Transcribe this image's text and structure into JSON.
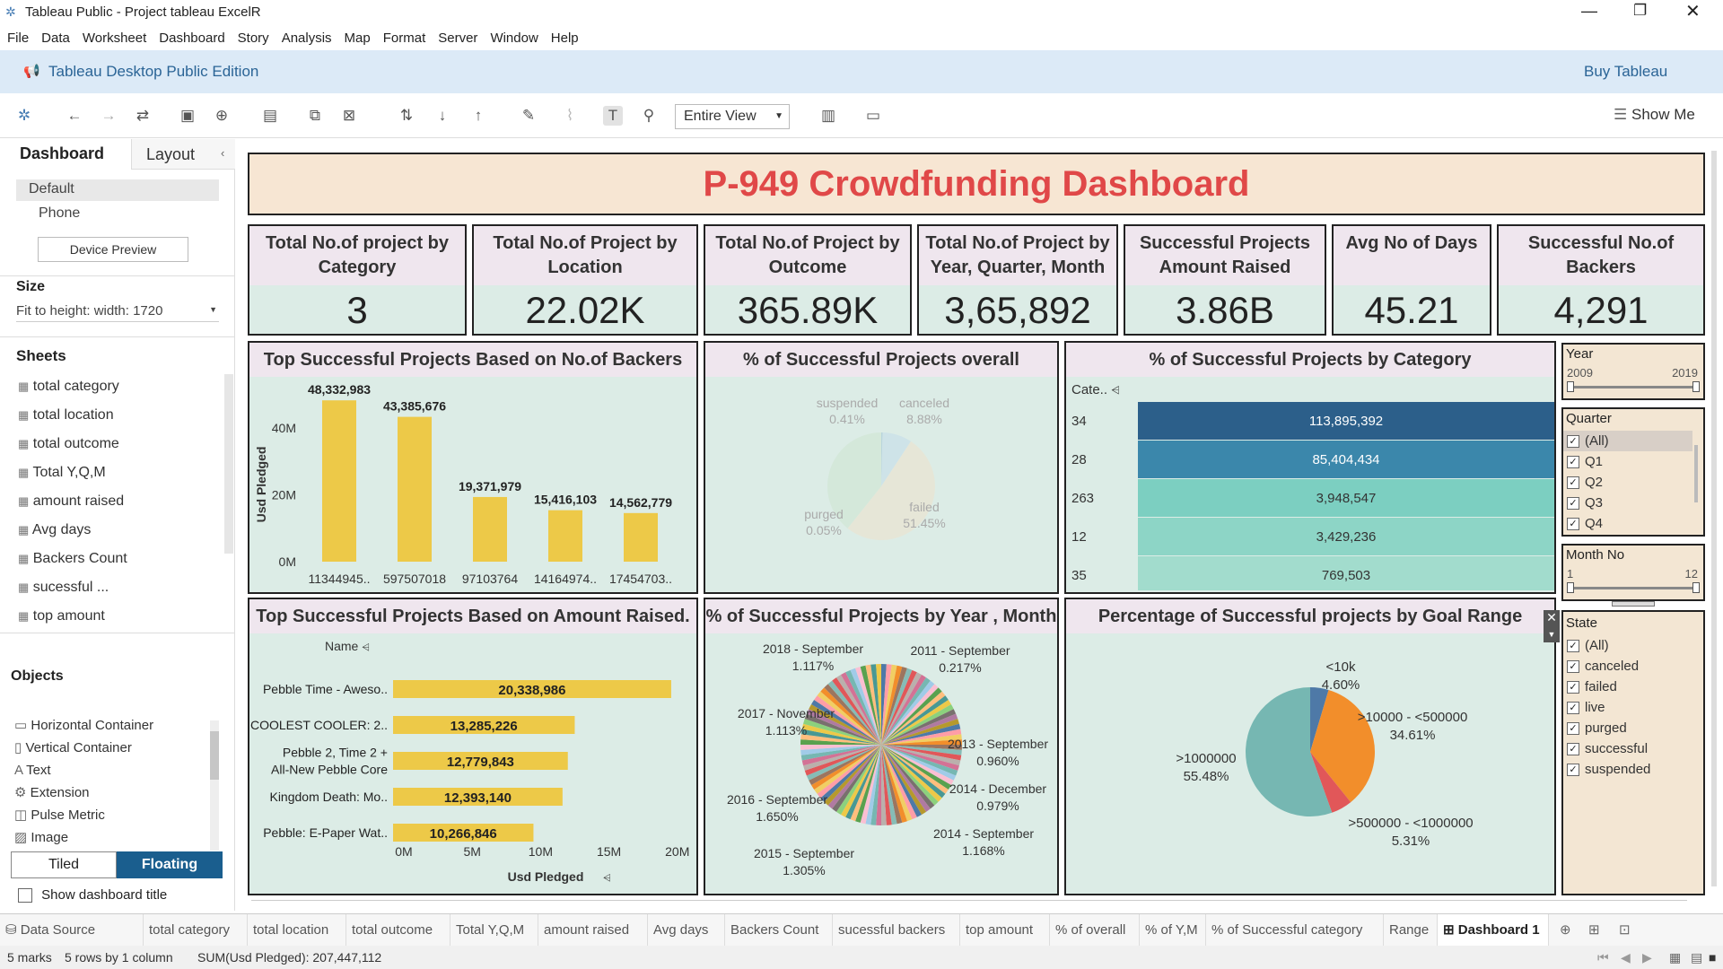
{
  "window": {
    "title": "Tableau Public - Project tableau ExcelR"
  },
  "menu": [
    "File",
    "Data",
    "Worksheet",
    "Dashboard",
    "Story",
    "Analysis",
    "Map",
    "Format",
    "Server",
    "Window",
    "Help"
  ],
  "edition": {
    "label": "Tableau Desktop Public Edition",
    "buy": "Buy Tableau"
  },
  "toolbar": {
    "view_select": "Entire View",
    "show_me": "Show Me"
  },
  "leftpane": {
    "tab_dashboard": "Dashboard",
    "tab_layout": "Layout",
    "device_default": "Default",
    "device_phone": "Phone",
    "device_preview": "Device Preview",
    "size_heading": "Size",
    "size_value": "Fit to height: width: 1720",
    "sheets_heading": "Sheets",
    "sheets": [
      "total category",
      "total location",
      "total outcome",
      "Total Y,Q,M",
      "amount raised",
      "Avg days",
      "Backers Count",
      "sucessful ...",
      "top amount"
    ],
    "objects_heading": "Objects",
    "objects": [
      "Horizontal Container",
      "Vertical Container",
      "Text",
      "Extension",
      "Pulse Metric",
      "Image"
    ],
    "tiled": "Tiled",
    "floating": "Floating",
    "show_title": "Show dashboard title"
  },
  "dashboard": {
    "title": "P-949 Crowdfunding Dashboard",
    "kpis": [
      {
        "label": "Total No.of project by Category",
        "value": "3"
      },
      {
        "label": "Total No.of Project by Location",
        "value": "22.02K"
      },
      {
        "label": "Total No.of Project by Outcome",
        "value": "365.89K"
      },
      {
        "label": "Total No.of Project by Year, Quarter, Month",
        "value": "3,65,892"
      },
      {
        "label": "Successful Projects Amount Raised",
        "value": "3.86B"
      },
      {
        "label": "Avg No of Days",
        "value": "45.21"
      },
      {
        "label": "Successful No.of Backers",
        "value": "4,291"
      }
    ],
    "backers_title": "Top Successful Projects Based on No.of Backers",
    "overall_title": "% of Successful Projects overall",
    "category_title": "% of Successful Projects  by Category",
    "category_header": "Cate..",
    "amount_title": "Top Successful Projects Based on Amount Raised.",
    "amount_col_header": "Name",
    "year_month_title": "% of Successful Projects by Year , Month",
    "goal_title": "Percentage of Successful projects by Goal Range"
  },
  "filters": {
    "year": {
      "label": "Year",
      "min": "2009",
      "max": "2019"
    },
    "quarter": {
      "label": "Quarter",
      "options": [
        "(All)",
        "Q1",
        "Q2",
        "Q3",
        "Q4"
      ]
    },
    "month": {
      "label": "Month No",
      "min": "1",
      "max": "12"
    },
    "state": {
      "label": "State",
      "options": [
        "(All)",
        "canceled",
        "failed",
        "live",
        "purged",
        "successful",
        "suspended"
      ]
    }
  },
  "tabs": [
    "Data Source",
    "total category",
    "total location",
    "total outcome",
    "Total Y,Q,M",
    "amount raised",
    "Avg days",
    "Backers Count",
    "sucessful backers",
    "top amount",
    "% of overall",
    "% of Y,M",
    "% of Successful category",
    "Range",
    "Dashboard 1"
  ],
  "status": {
    "marks": "5 marks",
    "rows": "5 rows by 1 column",
    "sum": "SUM(Usd Pledged): 207,447,112"
  },
  "chart_data": [
    {
      "type": "bar",
      "title": "Top Successful Projects Based on No.of Backers",
      "categories": [
        "11344945..",
        "597507018",
        "97103764",
        "14164974..",
        "17454703.."
      ],
      "values": [
        48332983,
        43385676,
        19371979,
        15416103,
        14562779
      ],
      "value_labels": [
        "48,332,983",
        "43,385,676",
        "19,371,979",
        "15,416,103",
        "14,562,779"
      ],
      "ylabel": "Usd Pledged",
      "ylim": [
        0,
        50000000
      ],
      "yticks": [
        "0M",
        "20M",
        "40M"
      ]
    },
    {
      "type": "pie",
      "title": "% of Successful Projects overall",
      "labels": [
        "suspended",
        "canceled",
        "failed",
        "purged"
      ],
      "value_labels": [
        "0.41%",
        "8.88%",
        "51.45%",
        "0.05%"
      ],
      "values": [
        0.41,
        8.88,
        51.45,
        0.05
      ],
      "colors": [
        "#9ec3d6",
        "#c4dcea",
        "#efe2cc",
        "#cfe5d2"
      ]
    },
    {
      "type": "table",
      "title": "% of Successful Projects  by Category",
      "categories": [
        "34",
        "28",
        "263",
        "12",
        "35"
      ],
      "values": [
        113895392,
        85404434,
        3948547,
        3429236,
        769503
      ],
      "value_labels": [
        "113,895,392",
        "85,404,434",
        "3,948,547",
        "3,429,236",
        "769,503"
      ],
      "colors": [
        "#2c5f8a",
        "#3b87ab",
        "#7ccfc1",
        "#8dd5c6",
        "#a2dccd"
      ]
    },
    {
      "type": "bar",
      "title": "Top Successful Projects Based on Amount Raised.",
      "categories": [
        "Pebble Time - Aweso..",
        "COOLEST COOLER: 2..",
        "Pebble 2, Time 2 + All-New Pebble Core",
        "Kingdom Death: Mo..",
        "Pebble: E-Paper Wat.."
      ],
      "values": [
        20338986,
        13285226,
        12779843,
        12393140,
        10266846
      ],
      "value_labels": [
        "20,338,986",
        "13,285,226",
        "12,779,843",
        "12,393,140",
        "10,266,846"
      ],
      "xlabel": "Usd Pledged",
      "xlim": [
        0,
        21000000
      ],
      "xticks": [
        "0M",
        "5M",
        "10M",
        "15M",
        "20M"
      ]
    },
    {
      "type": "pie",
      "title": "% of Successful Projects by Year , Month",
      "labels": [
        "2018 - September",
        "2011 - September",
        "2017 - November",
        "2013 - September",
        "2014 - December",
        "2016 - September",
        "2014 - September",
        "2015 - September"
      ],
      "value_labels": [
        "1.117%",
        "0.217%",
        "1.113%",
        "0.960%",
        "0.979%",
        "1.650%",
        "1.168%",
        "1.305%"
      ]
    },
    {
      "type": "pie",
      "title": "Percentage of Successful projects by Goal Range",
      "labels": [
        "<10k",
        ">10000 - <500000",
        ">500000 - <1000000",
        ">1000000"
      ],
      "value_labels": [
        "4.60%",
        "34.61%",
        "5.31%",
        "55.48%"
      ],
      "values": [
        4.6,
        34.61,
        5.31,
        55.48
      ],
      "colors": [
        "#4e79a7",
        "#f28e2b",
        "#e15759",
        "#76b7b2"
      ]
    }
  ]
}
